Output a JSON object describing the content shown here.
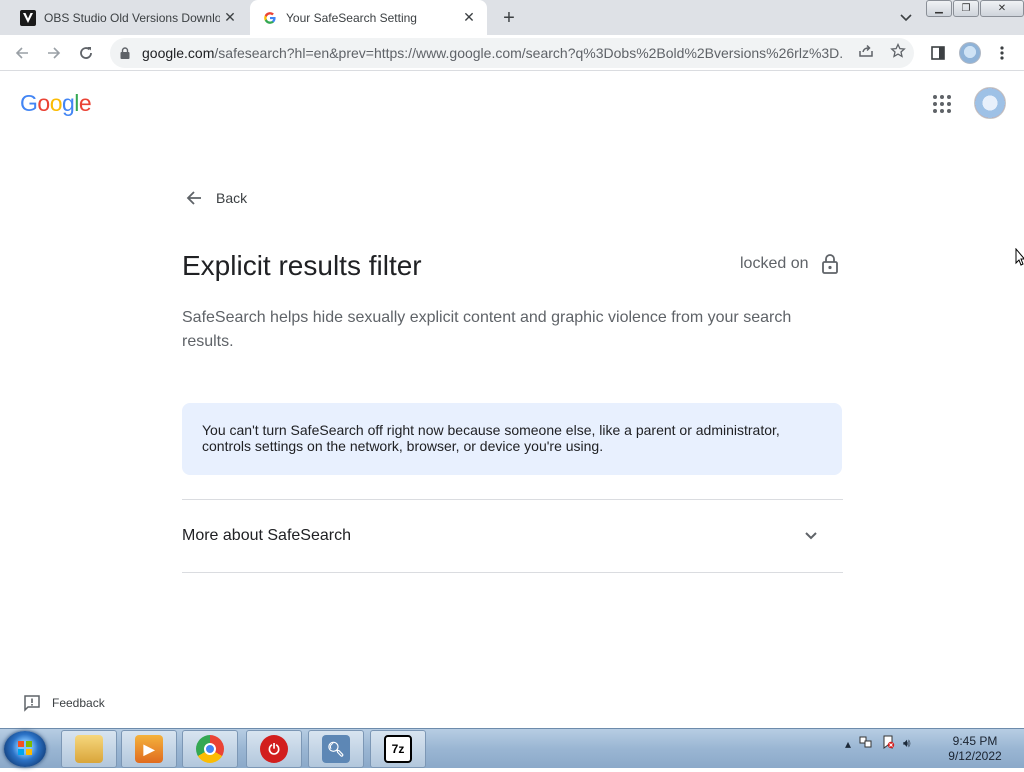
{
  "browser": {
    "tabs": [
      {
        "title": "OBS Studio Old Versions Downlo",
        "favicon": "v-logo-icon",
        "active": false
      },
      {
        "title": "Your SafeSearch Setting",
        "favicon": "google-g-icon",
        "active": true
      }
    ],
    "url_host": "google.com",
    "url_path": "/safesearch?hl=en&prev=https://www.google.com/search?q%3Dobs%2Bold%2Bversions%26rlz%3D..."
  },
  "page": {
    "logo_text": "Google",
    "back_label": "Back",
    "title": "Explicit results filter",
    "status_label": "locked on",
    "description": "SafeSearch helps hide sexually explicit content and graphic violence from your search results.",
    "notice": "You can't turn SafeSearch off right now because someone else, like a parent or administrator, controls settings on the network, browser, or device you're using.",
    "more_label": "More about SafeSearch",
    "feedback_label": "Feedback"
  },
  "taskbar": {
    "time": "9:45 PM",
    "date": "9/12/2022",
    "apps": [
      "file-explorer-icon",
      "media-player-icon",
      "chrome-icon",
      "power-icon",
      "magnifier-app-icon",
      "7zip-icon"
    ]
  },
  "colors": {
    "google_blue": "#4285F4",
    "google_red": "#EA4335",
    "google_yellow": "#FBBC05",
    "google_green": "#34A853",
    "notice_bg": "#e8f0fe"
  }
}
